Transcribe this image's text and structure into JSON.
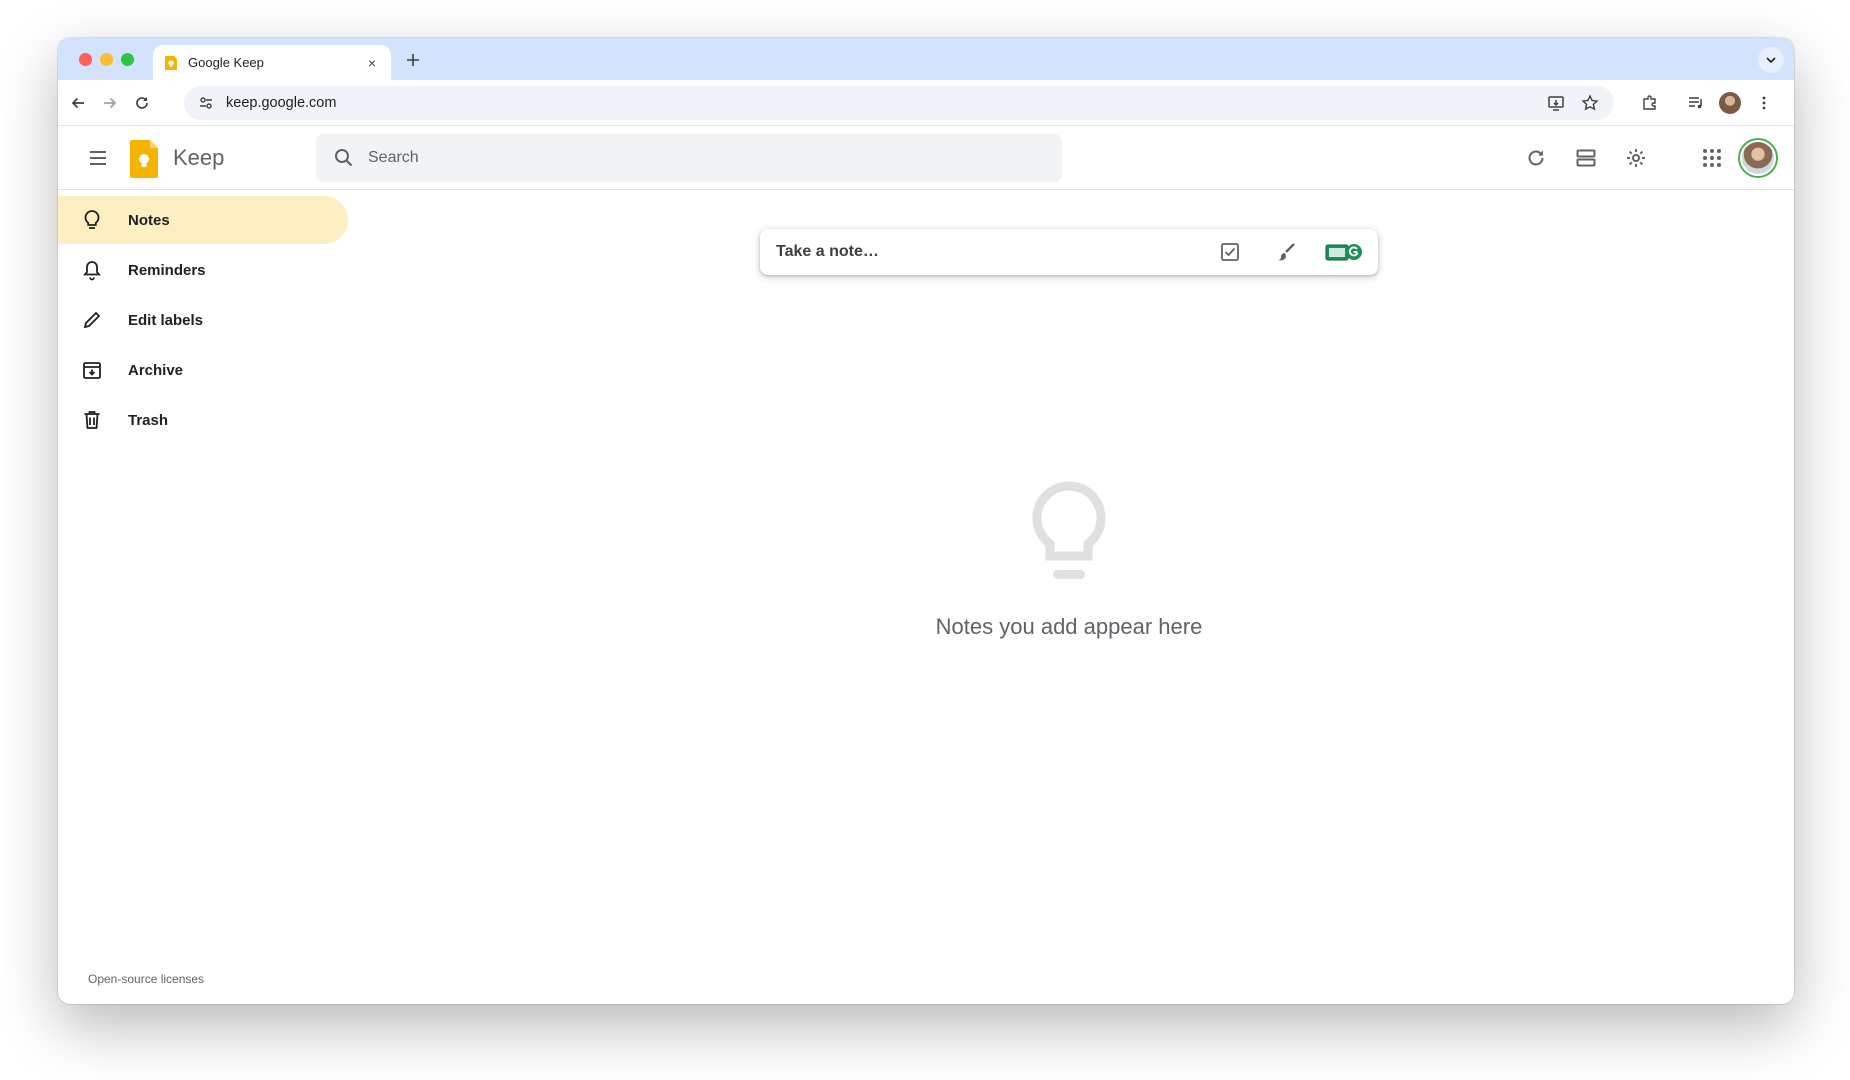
{
  "browser": {
    "tab_title": "Google Keep",
    "tab_close": "×",
    "new_tab": "+",
    "url": "keep.google.com"
  },
  "header": {
    "app_name": "Keep",
    "search_placeholder": "Search"
  },
  "sidebar": {
    "items": [
      {
        "label": "Notes",
        "icon": "lightbulb-icon",
        "active": true
      },
      {
        "label": "Reminders",
        "icon": "bell-icon",
        "active": false
      },
      {
        "label": "Edit labels",
        "icon": "pencil-icon",
        "active": false
      },
      {
        "label": "Archive",
        "icon": "archive-icon",
        "active": false
      },
      {
        "label": "Trash",
        "icon": "trash-icon",
        "active": false
      }
    ],
    "footer_link": "Open-source licenses"
  },
  "main": {
    "note_placeholder": "Take a note…",
    "empty_message": "Notes you add appear here"
  },
  "colors": {
    "active_nav_bg": "#feefc3",
    "keep_yellow": "#f4b400",
    "tabstrip_bg": "#d3e3fd"
  }
}
